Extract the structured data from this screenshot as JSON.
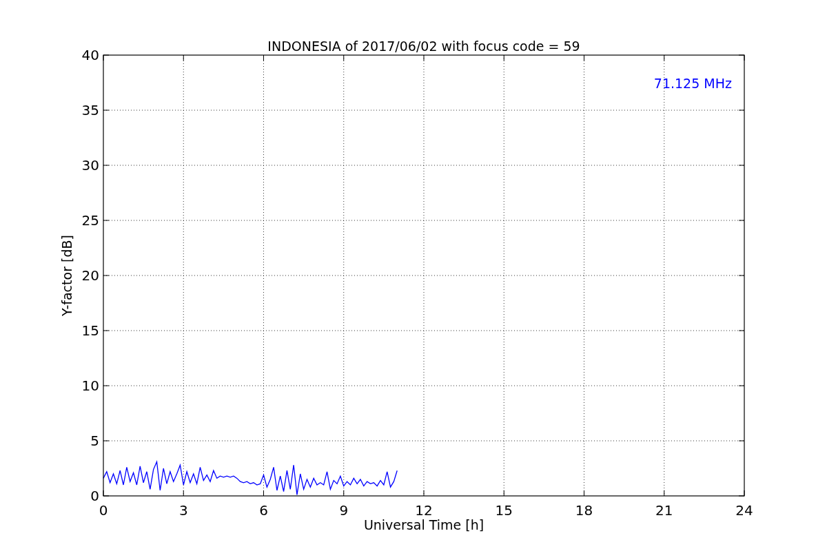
{
  "plot": {
    "chart_data": {
      "type": "line",
      "title": "INDONESIA of 2017/06/02 with focus code = 59",
      "xlabel": "Universal Time [h]",
      "ylabel": "Y-factor [dB]",
      "x": [
        0,
        0.125,
        0.25,
        0.375,
        0.5,
        0.625,
        0.75,
        0.875,
        1,
        1.125,
        1.25,
        1.375,
        1.5,
        1.625,
        1.75,
        1.875,
        2,
        2.125,
        2.25,
        2.375,
        2.5,
        2.625,
        2.75,
        2.875,
        3,
        3.125,
        3.25,
        3.375,
        3.5,
        3.625,
        3.75,
        3.875,
        4,
        4.125,
        4.25,
        4.375,
        4.5,
        4.625,
        4.75,
        4.875,
        5,
        5.125,
        5.25,
        5.375,
        5.5,
        5.625,
        5.75,
        5.875,
        6,
        6.125,
        6.25,
        6.375,
        6.5,
        6.625,
        6.75,
        6.875,
        7,
        7.125,
        7.25,
        7.375,
        7.5,
        7.625,
        7.75,
        7.875,
        8,
        8.125,
        8.25,
        8.375,
        8.5,
        8.625,
        8.75,
        8.875,
        9,
        9.125,
        9.25,
        9.375,
        9.5,
        9.625,
        9.75,
        9.875,
        10,
        10.125,
        10.25,
        10.375,
        10.5,
        10.625,
        10.75,
        10.875,
        11
      ],
      "series": [
        {
          "name": "71.125 MHz",
          "color": "#0000ff",
          "values": [
            1.6,
            2.2,
            1.2,
            2.0,
            1.1,
            2.3,
            1.0,
            2.6,
            1.3,
            2.1,
            1.0,
            2.7,
            1.2,
            2.2,
            0.6,
            2.4,
            3.1,
            0.5,
            2.5,
            1.1,
            2.2,
            1.3,
            2.0,
            2.8,
            1.0,
            2.2,
            1.2,
            2.0,
            1.1,
            2.6,
            1.4,
            1.9,
            1.3,
            2.3,
            1.6,
            1.8,
            1.7,
            1.8,
            1.7,
            1.8,
            1.6,
            1.3,
            1.2,
            1.3,
            1.1,
            1.2,
            1.0,
            1.1,
            1.9,
            0.8,
            1.5,
            2.6,
            0.5,
            1.8,
            0.4,
            2.3,
            0.6,
            2.8,
            0.1,
            2.0,
            0.6,
            1.5,
            0.8,
            1.6,
            1.0,
            1.2,
            1.0,
            2.2,
            0.6,
            1.4,
            1.1,
            1.8,
            0.9,
            1.3,
            1.0,
            1.6,
            1.1,
            1.5,
            0.9,
            1.3,
            1.1,
            1.2,
            0.9,
            1.4,
            1.0,
            2.2,
            0.8,
            1.3,
            2.3
          ]
        }
      ],
      "xlim": [
        0,
        24
      ],
      "ylim": [
        0,
        40
      ],
      "xticks": [
        0,
        3,
        6,
        9,
        12,
        15,
        18,
        21,
        24
      ],
      "yticks": [
        0,
        5,
        10,
        15,
        20,
        25,
        30,
        35,
        40
      ],
      "grid": true
    }
  }
}
